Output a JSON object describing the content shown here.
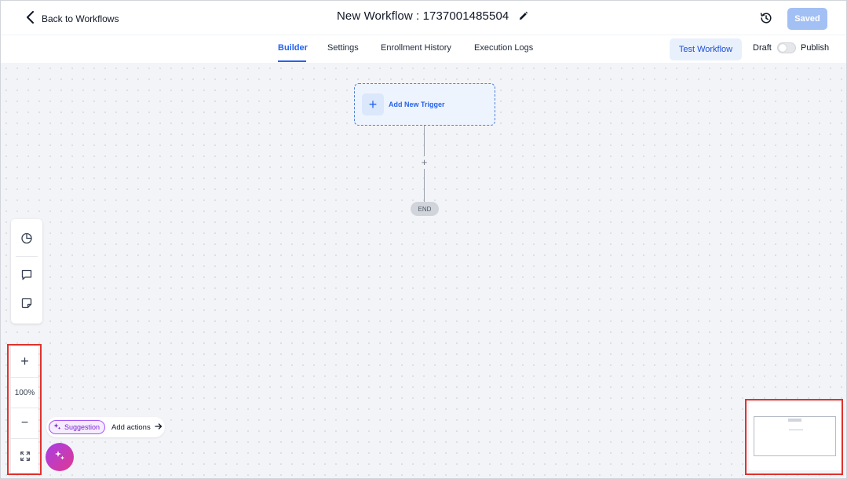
{
  "header": {
    "back_label": "Back to Workflows",
    "title": "New Workflow : 1737001485504",
    "saved_label": "Saved"
  },
  "tabs": [
    {
      "label": "Builder",
      "active": true
    },
    {
      "label": "Settings",
      "active": false
    },
    {
      "label": "Enrollment History",
      "active": false
    },
    {
      "label": "Execution Logs",
      "active": false
    }
  ],
  "toolbar": {
    "test_label": "Test Workflow",
    "draft_label": "Draft",
    "publish_label": "Publish",
    "publish_toggle_on": false
  },
  "canvas": {
    "trigger_label": "Add New Trigger",
    "add_step_symbol": "+",
    "end_label": "END"
  },
  "zoom": {
    "level": "100%",
    "zoom_in_symbol": "+",
    "zoom_out_symbol": "−"
  },
  "suggestion": {
    "badge_label": "Suggestion",
    "action_label": "Add actions"
  },
  "icons": {
    "back": "chevron-left-icon",
    "edit": "pencil-icon",
    "history": "history-icon",
    "stats": "pie-chart-icon",
    "comment": "comment-icon",
    "note": "sticky-note-icon",
    "fit": "fit-view-icon",
    "sparkle": "sparkle-icon",
    "arrow": "arrow-right-icon"
  },
  "colors": {
    "accent": "#2563eb",
    "saved_button": "#a3c0f5",
    "highlight": "#e0322d",
    "ai_gradient_start": "#a63ee8",
    "ai_gradient_end": "#e0398f"
  }
}
